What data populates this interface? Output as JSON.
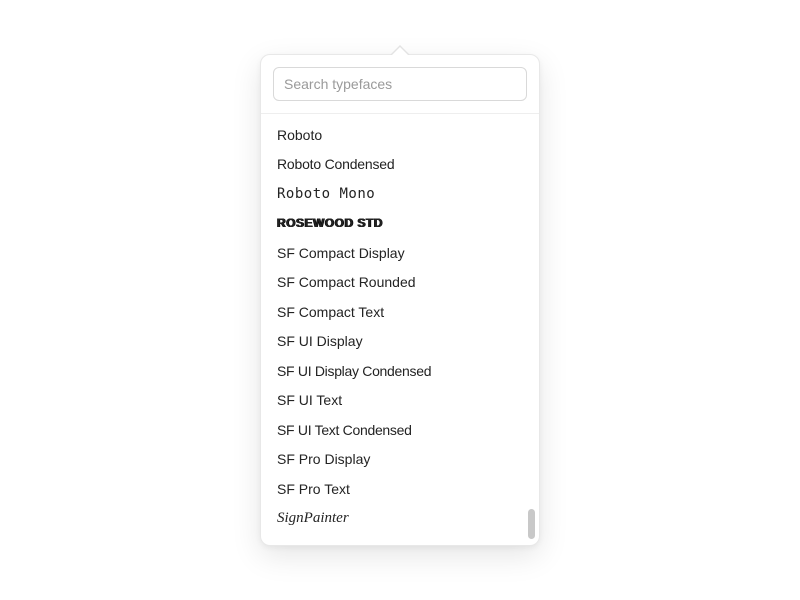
{
  "search": {
    "placeholder": "Search typefaces",
    "value": ""
  },
  "fonts": [
    {
      "label": "Roboto",
      "style_key": "f-roboto"
    },
    {
      "label": "Roboto Condensed",
      "style_key": "f-roboto-cond"
    },
    {
      "label": "Roboto Mono",
      "style_key": "f-roboto-mono"
    },
    {
      "label": "ROSEWOOD STD",
      "style_key": "f-rosewood"
    },
    {
      "label": "SF Compact Display",
      "style_key": "f-sf"
    },
    {
      "label": "SF Compact Rounded",
      "style_key": "f-sf"
    },
    {
      "label": "SF Compact Text",
      "style_key": "f-sf"
    },
    {
      "label": "SF UI Display",
      "style_key": "f-sf"
    },
    {
      "label": "SF UI Display Condensed",
      "style_key": "f-sf-cond"
    },
    {
      "label": "SF UI Text",
      "style_key": "f-sf"
    },
    {
      "label": "SF UI Text Condensed",
      "style_key": "f-sf-cond"
    },
    {
      "label": "SF Pro Display",
      "style_key": "f-sf"
    },
    {
      "label": "SF Pro Text",
      "style_key": "f-sf"
    },
    {
      "label": "SignPainter",
      "style_key": "f-signpainter"
    }
  ]
}
